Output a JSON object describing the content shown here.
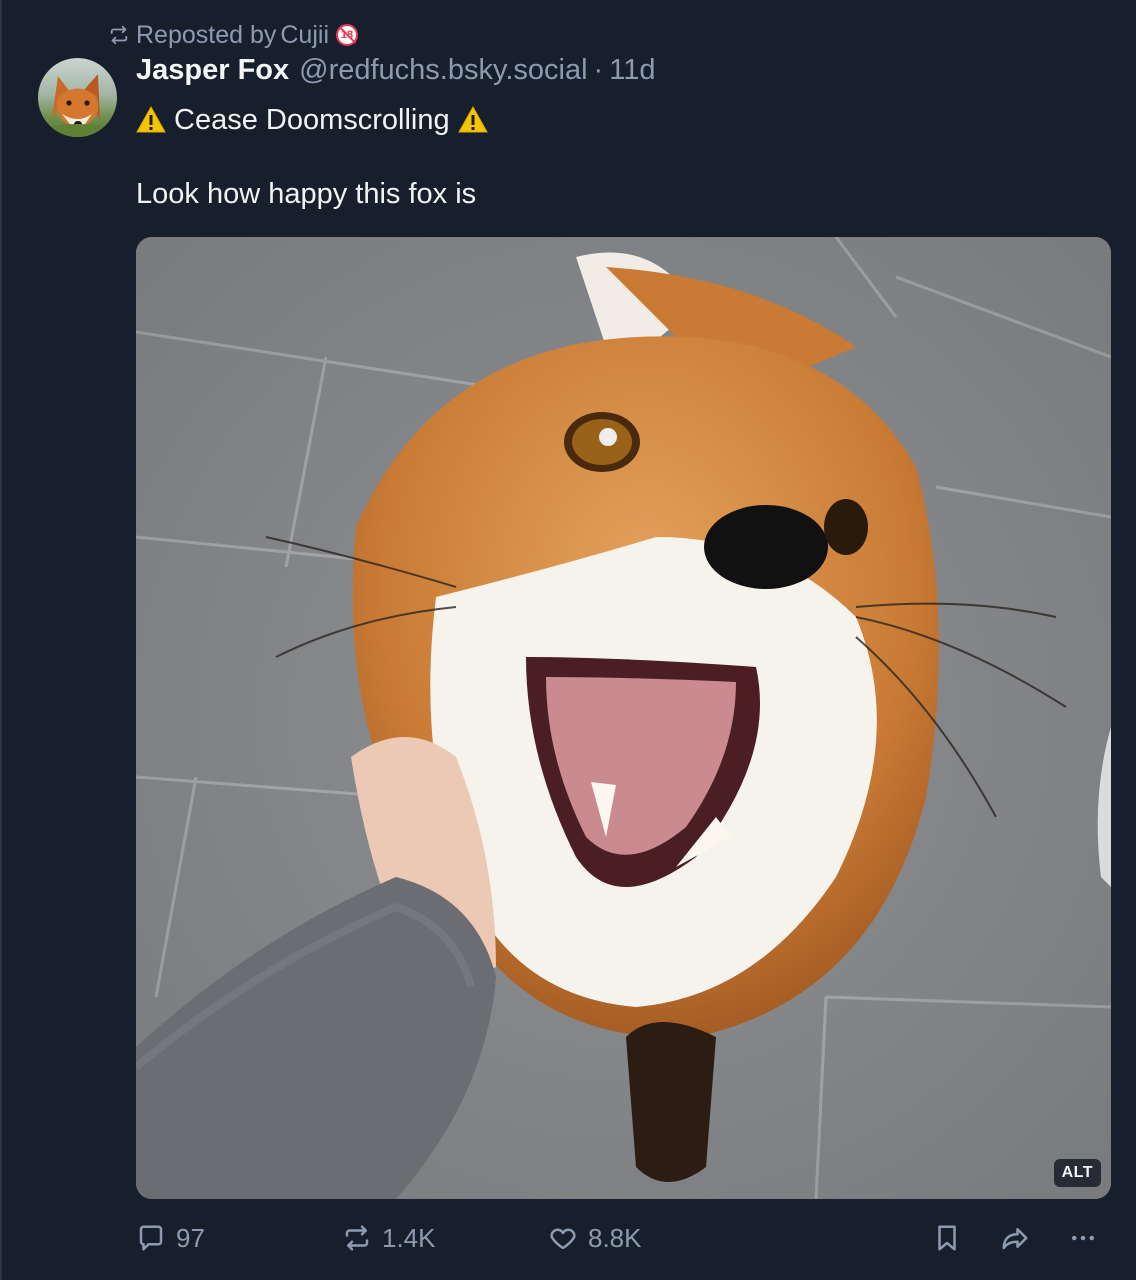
{
  "repost": {
    "prefix": "Reposted by",
    "name": "Cujii",
    "badge_icon": "no-18-icon"
  },
  "author": {
    "display_name": "Jasper Fox",
    "handle": "@redfuchs.bsky.social",
    "separator": "·",
    "time_ago": "11d",
    "avatar_icon": "fox-avatar"
  },
  "pronouns_line": {
    "text": "Cease Doomscrolling",
    "icon": "warning-icon"
  },
  "post": {
    "text": "Look how happy this fox is"
  },
  "media": {
    "alt_label": "ALT",
    "description_icon": "fox-photo"
  },
  "actions": {
    "reply_count": "97",
    "repost_count": "1.4K",
    "like_count": "8.8K"
  },
  "colors": {
    "background": "#171f2c",
    "muted_text": "#8d9bb0",
    "primary_text": "#f1f3f5",
    "warning_yellow": "#f5c400"
  }
}
